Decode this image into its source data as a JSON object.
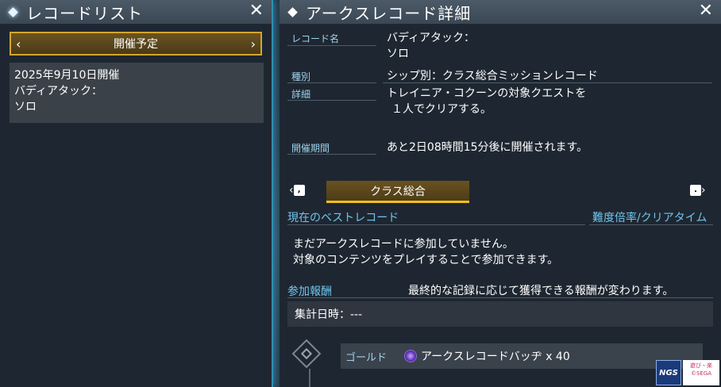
{
  "left_panel": {
    "title": "レコードリスト",
    "close": "✕",
    "tab": {
      "prev": "‹",
      "label": "開催予定",
      "next": "›"
    },
    "record": {
      "date": "2025年9月10日開催",
      "name_line1": "バディアタック：",
      "name_line2": "ソロ"
    }
  },
  "right_panel": {
    "title": "アークスレコード詳細",
    "close": "✕",
    "fields": {
      "record_name_label": "レコード名",
      "record_name_line1": "バディアタック：",
      "record_name_line2": "ソロ",
      "type_label": "種別",
      "type_value": "シップ別：クラス総合ミッションレコード",
      "detail_label": "詳細",
      "detail_line1": "トレイニア・コクーンの対象クエストを",
      "detail_line2": "１人でクリアする。",
      "period_label": "開催期間",
      "period_value": "あと2日08時間15分後に開催されます。"
    },
    "category_tab": {
      "label": "クラス総合",
      "prev_key": ",",
      "next_key": "."
    },
    "best_record": {
      "heading": "現在のベストレコード",
      "right_heading": "難度倍率/クリアタイム",
      "msg_line1": "まだアークスレコードに参加していません。",
      "msg_line2": "対象のコンテンツをプレイすることで参加できます。"
    },
    "rewards": {
      "heading": "参加報酬",
      "note": "最終的な記録に応じて獲得できる報酬が変わります。",
      "tally": "集計日時：---",
      "rows": [
        {
          "tier": "ゴールド",
          "item": "アークスレコードバッヂ x 40",
          "icon": "badge-icon"
        }
      ]
    }
  },
  "logos": {
    "ngs": "NGS",
    "corp_line1": "遊び・楽",
    "corp_line2": "©SEGA"
  },
  "colors": {
    "accent_gold": "#d4a62a",
    "label_blue": "#9fd2ec",
    "heading_blue": "#6fc4ee",
    "panel_bg": "#1e2731"
  }
}
